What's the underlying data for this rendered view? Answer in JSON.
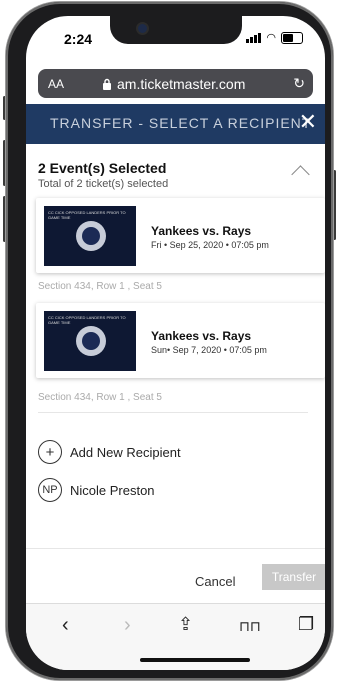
{
  "status": {
    "time": "2:24"
  },
  "browser": {
    "aa": "AA",
    "url": "am.ticketmaster.com",
    "reload_icon": "reload-icon",
    "lock_icon": "lock-icon"
  },
  "header": {
    "title": "TRANSFER - SELECT A RECIPIENT",
    "close": "✕"
  },
  "selection": {
    "title": "2 Event(s) Selected",
    "subtitle": "Total of 2 ticket(s) selected"
  },
  "events": [
    {
      "title": "Yankees vs. Rays",
      "date": "Fri • Sep 25, 2020 • 07:05 pm",
      "seat": "Section 434, Row 1 , Seat 5",
      "thumb_caption": "CC CICK OPPOSED LANDERS PRIOR TO GAME TIME"
    },
    {
      "title": "Yankees vs. Rays",
      "date": "Sun• Sep 7, 2020 • 07:05 pm",
      "seat": "Section 434, Row 1 , Seat 5",
      "thumb_caption": "CC CICK OPPOSED LANDERS PRIOR TO GAME TIME"
    }
  ],
  "recipients": {
    "add": {
      "icon": "+",
      "label": "Add New Recipient"
    },
    "contacts": [
      {
        "initials": "NP",
        "name": "Nicole Preston"
      }
    ]
  },
  "footer": {
    "cancel": "Cancel",
    "transfer": "Transfer"
  },
  "toolbar": {
    "back": "‹",
    "forward": "›",
    "share": "⇪",
    "bookmarks": "⊓⊓",
    "tabs": "❐"
  },
  "colors": {
    "header_bg": "#1f3a63",
    "transfer_disabled": "#c8c8c8"
  }
}
